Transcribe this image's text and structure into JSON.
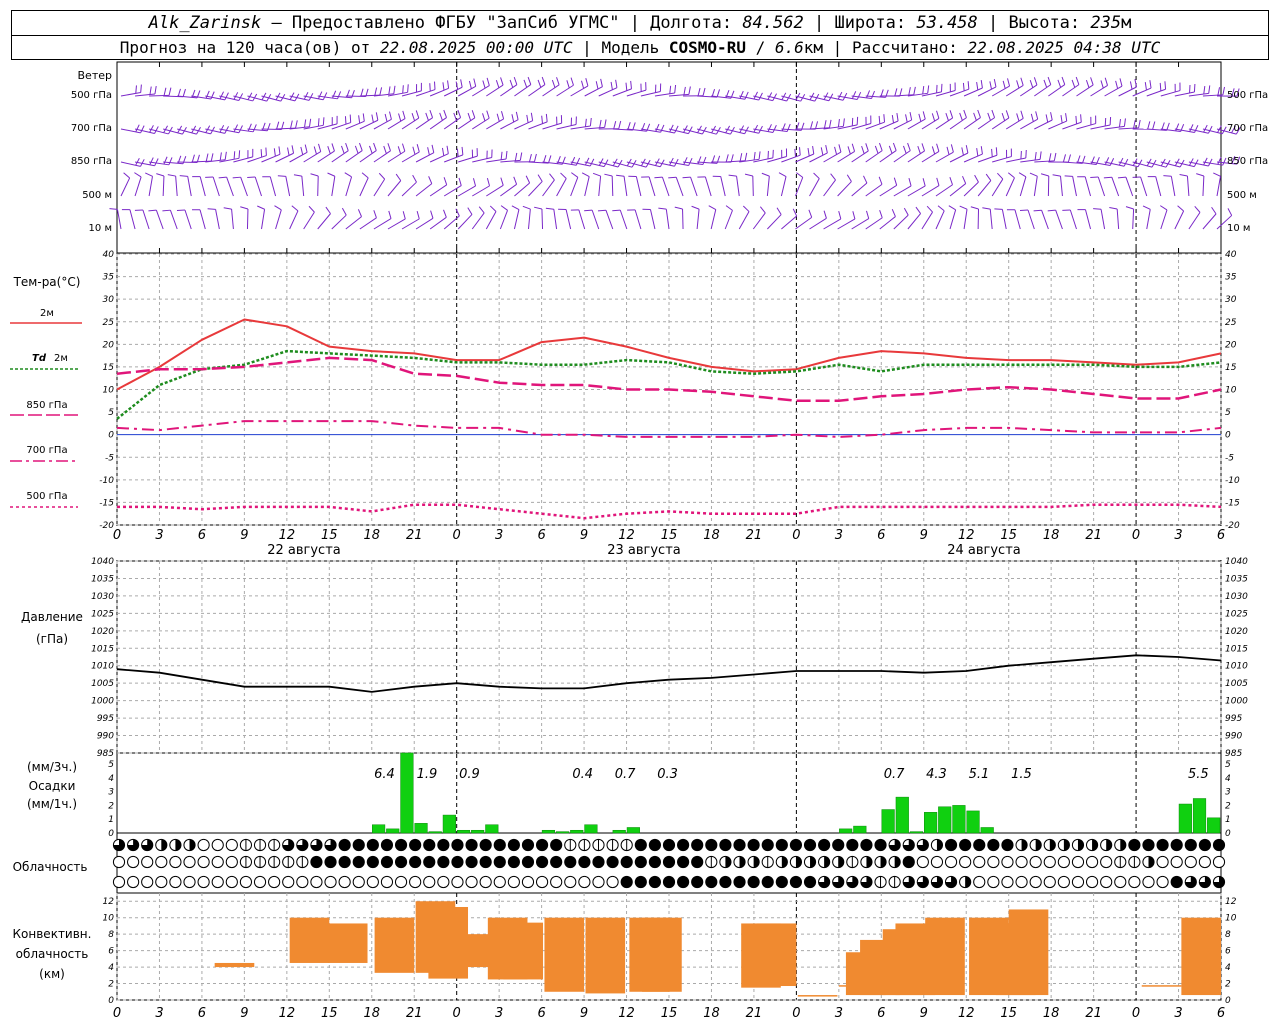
{
  "header": {
    "station": "Alk_Zarinsk",
    "provider": "– Предоставлено ФГБУ \"ЗапСиб УГМС\"",
    "lon_label": "Долгота:",
    "lon": "84.562",
    "lat_label": "Широта:",
    "lat": "53.458",
    "alt_label": "Высота:",
    "alt": "235",
    "alt_unit": "м",
    "forecast_label": "Прогноз на 120 часа(ов) от",
    "forecast_time": "22.08.2025 00:00 UTC",
    "model_label": "Модель",
    "model": "COSMO-RU",
    "model_res": "6.6",
    "model_res_unit": "км",
    "calc_label": "Рассчитано:",
    "calc_time": "22.08.2025 04:38 UTC"
  },
  "labels": {
    "wind": "Ветер",
    "wind_levels": [
      "500 гПа",
      "700 гПа",
      "850 гПа",
      "500 м",
      "10 м"
    ],
    "temp": "Тем-ра(°С)",
    "leg_2m": "2м",
    "leg_td": "Td",
    "leg_td2": "2м",
    "leg_850": "850 гПа",
    "leg_700": "700 гПа",
    "leg_500": "500 гПа",
    "pressure1": "Давление",
    "pressure2": "(гПа)",
    "precip_unit1": "(мм/3ч.)",
    "precip": "Осадки",
    "precip_unit2": "(мм/1ч.)",
    "cloud": "Облачность",
    "conv1": "Конвективн.",
    "conv2": "облачность",
    "conv3": "(км)"
  },
  "colors": {
    "t2m": "#e8393b",
    "td": "#1e8c1e",
    "t850": "#e0157a",
    "t700": "#e0157a",
    "t500": "#e0157a",
    "wind": "#7a28c8",
    "precip": "#10d010",
    "conv": "#f08a30",
    "pres": "#000000"
  },
  "chart_data": [
    {
      "type": "line",
      "title": "Тем-ра(°С)",
      "x_hours_tick_labels": [
        "0",
        "3",
        "6",
        "9",
        "12",
        "15",
        "18",
        "21",
        "0",
        "3",
        "6",
        "9",
        "12",
        "15",
        "18",
        "21",
        "0",
        "3",
        "6",
        "9",
        "12",
        "15",
        "18",
        "21",
        "0",
        "3",
        "6"
      ],
      "day_labels": [
        "22 августа",
        "23 августа",
        "24 августа"
      ],
      "ylim": [
        -20,
        40
      ],
      "y_ticks": [
        "40",
        "35",
        "30",
        "25",
        "20",
        "15",
        "10",
        "5",
        "0",
        "-5",
        "-10",
        "-15",
        "-20"
      ],
      "x_hours": [
        0,
        3,
        6,
        9,
        12,
        15,
        18,
        21,
        24,
        27,
        30,
        33,
        36,
        39,
        42,
        45,
        48,
        51,
        54,
        57,
        60,
        63,
        66,
        69,
        72,
        75,
        78
      ],
      "series": [
        {
          "name": "2м",
          "values": [
            10,
            15,
            21,
            25.5,
            24,
            19.5,
            18.5,
            18,
            16.5,
            16.5,
            20.5,
            21.5,
            19.5,
            17,
            15,
            14,
            14.5,
            17,
            18.5,
            18,
            17,
            16.5,
            16.5,
            16,
            15.5,
            16,
            18
          ]
        },
        {
          "name": "Td 2м",
          "values": [
            3.5,
            11,
            14.5,
            15.5,
            18.5,
            18,
            17.5,
            17,
            16,
            16,
            15.5,
            15.5,
            16.5,
            16,
            14,
            13.5,
            14,
            15.5,
            14,
            15.5,
            15.5,
            15.5,
            15.5,
            15.5,
            15,
            15,
            16
          ]
        },
        {
          "name": "850 гПа",
          "values": [
            13.5,
            14.5,
            14.5,
            15,
            16,
            17,
            16.5,
            13.5,
            13,
            11.5,
            11,
            11,
            10,
            10,
            9.5,
            8.5,
            7.5,
            7.5,
            8.5,
            9,
            10,
            10.5,
            10,
            9,
            8,
            8,
            10
          ]
        },
        {
          "name": "700 гПа",
          "values": [
            1.5,
            1,
            2,
            3,
            3,
            3,
            3,
            2,
            1.5,
            1.5,
            0,
            0,
            -0.5,
            -0.5,
            -0.5,
            -0.5,
            0,
            -0.5,
            0,
            1,
            1.5,
            1.5,
            1,
            0.5,
            0.5,
            0.5,
            1.5
          ]
        },
        {
          "name": "500 гПа",
          "values": [
            -16,
            -16,
            -16.5,
            -16,
            -16,
            -16,
            -17,
            -15.5,
            -15.5,
            -16.5,
            -17.5,
            -18.5,
            -17.5,
            -17,
            -17.5,
            -17.5,
            -17.5,
            -16,
            -16,
            -16,
            -16,
            -16,
            -16,
            -15.5,
            -15.5,
            -15.5,
            -16
          ]
        }
      ]
    },
    {
      "type": "line",
      "title": "Давление (гПа)",
      "ylim": [
        985,
        1040
      ],
      "y_ticks": [
        "1040",
        "1035",
        "1030",
        "1025",
        "1020",
        "1015",
        "1010",
        "1005",
        "1000",
        "995",
        "990",
        "985"
      ],
      "x_hours": [
        0,
        3,
        6,
        9,
        12,
        15,
        18,
        21,
        24,
        27,
        30,
        33,
        36,
        39,
        42,
        45,
        48,
        51,
        54,
        57,
        60,
        63,
        66,
        69,
        72,
        75,
        78
      ],
      "series": [
        {
          "name": "Давление",
          "values": [
            1009,
            1008,
            1006,
            1004,
            1004,
            1004,
            1002.5,
            1004,
            1005,
            1004,
            1003.5,
            1003.5,
            1005,
            1006,
            1006.5,
            1007.5,
            1008.5,
            1008.5,
            1008.5,
            1008,
            1008.5,
            1010,
            1011,
            1012,
            1013,
            1012.5,
            1011.5
          ]
        }
      ]
    },
    {
      "type": "bar",
      "title": "Осадки",
      "ylim": [
        0,
        5
      ],
      "y_ticks": [
        "5",
        "4",
        "3",
        "2",
        "1",
        "0"
      ],
      "three_hour_labels": [
        "6.4",
        "1.9",
        "0.9",
        "0.4",
        "0.7",
        "0.3",
        "0.7",
        "4.3",
        "5.1",
        "1.5",
        "5.5"
      ],
      "hours": [
        18,
        19,
        20,
        21,
        22,
        23,
        24,
        25,
        26,
        27,
        30,
        31,
        32,
        33,
        34,
        35,
        36,
        37,
        51,
        52,
        54,
        55,
        56,
        57,
        58,
        59,
        60,
        61,
        62,
        63,
        75,
        76,
        77
      ],
      "values": [
        0.6,
        0.3,
        5.8,
        0.7,
        0.1,
        1.3,
        0.2,
        0.2,
        0.6,
        0.0,
        0.2,
        0.1,
        0.2,
        0.6,
        0.0,
        0.2,
        0.4,
        0.0,
        0.3,
        0.5,
        1.7,
        2.6,
        0.1,
        1.5,
        1.9,
        2.0,
        1.6,
        0.4,
        0.0,
        0.0,
        2.1,
        2.5,
        1.1
      ]
    },
    {
      "type": "bar",
      "title": "Конвективн. облачность (км)",
      "ylim": [
        0,
        13
      ],
      "y_ticks": [
        "12",
        "10",
        "8",
        "6",
        "4",
        "2",
        "0"
      ],
      "hours_bottom_top": [
        [
          6.9,
          4,
          4.5
        ],
        [
          12.2,
          4.5,
          10
        ],
        [
          14.9,
          4.5,
          9.3
        ],
        [
          18.2,
          3.3,
          10
        ],
        [
          21.1,
          3.3,
          12
        ],
        [
          22,
          2.6,
          11.3
        ],
        [
          24.2,
          4,
          8
        ],
        [
          26.2,
          2.5,
          10
        ],
        [
          27.3,
          2.5,
          9.4
        ],
        [
          30.2,
          1,
          10
        ],
        [
          33.1,
          0.8,
          10
        ],
        [
          36.2,
          1,
          10
        ],
        [
          37.1,
          1,
          10
        ],
        [
          44.1,
          1.5,
          9.3
        ],
        [
          45.2,
          1.7,
          9.3
        ],
        [
          48.1,
          0.6,
          0.6
        ],
        [
          51,
          1.8,
          1.8
        ],
        [
          51.5,
          0.6,
          5.8
        ],
        [
          52.5,
          0.6,
          7.3
        ],
        [
          54.1,
          0.6,
          8.6
        ],
        [
          55,
          0.6,
          9.3
        ],
        [
          57.1,
          0.6,
          10
        ],
        [
          60.2,
          0.6,
          10
        ],
        [
          62.1,
          0.6,
          9.3
        ],
        [
          63,
          0.6,
          11
        ],
        [
          72.4,
          1.7,
          1.8
        ],
        [
          75.2,
          0.6,
          10
        ]
      ]
    }
  ],
  "cloud_rows": {
    "row1": "dddhhhoooqqqddddffffffffffffffffqqqqqffffffffffffffffffdddhfffffhhhhhhhhffffffffffffffffffffddhqqqqqqqqqqqqqqfdffffffffffffffddhhhhhhhfff",
    "row2": "oooooooooqqqqqffffffffffffffffffffffffffffqhhhqhhhhhqhhhfooooooooooooooqqhoooooqffffffffffffffffffqoooooooooooqooooqfffffffffff",
    "row3": "ooooooooooooooooooooooooooooooooooooffffffffffffffddddqqddddhoooooooooooooofdddffffffffffffffffffffhoooooooooooooooofdffffffff"
  }
}
